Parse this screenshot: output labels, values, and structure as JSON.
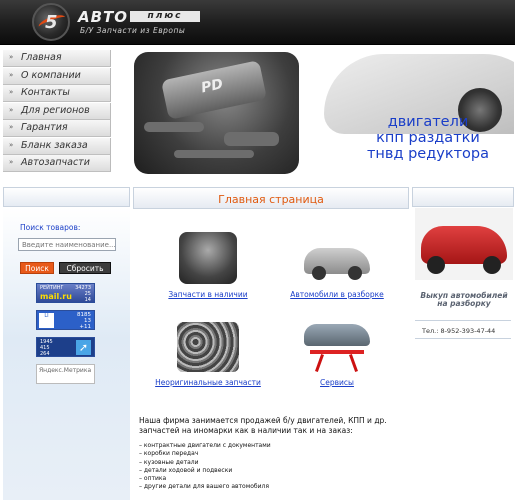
{
  "header": {
    "logo_number": "5",
    "brand": "АВТО",
    "brand_plus": "плюс",
    "tagline": "Б/У Запчасти из Европы"
  },
  "nav": {
    "items": [
      {
        "label": "Главная"
      },
      {
        "label": "О компании"
      },
      {
        "label": "Контакты"
      },
      {
        "label": "Для регионов"
      },
      {
        "label": "Гарантия"
      },
      {
        "label": "Бланк заказа"
      },
      {
        "label": "Автозапчасти"
      }
    ]
  },
  "banner": {
    "engine_badge": "PD",
    "line1": "двигатели",
    "line2": "кпп раздатки",
    "line3": "тнвд редуктора"
  },
  "search": {
    "label": "Поиск товаров:",
    "placeholder": "Введите наименование...",
    "search_button": "Поиск",
    "reset_button": "Сбросить"
  },
  "counters": {
    "mail": {
      "brand_top": "РЕЙТИНГ",
      "brand": "mail.ru",
      "nums": [
        "34273",
        "25",
        "14"
      ]
    },
    "li": {
      "icon_text": "LI",
      "nums": [
        "8185",
        "13",
        "+11"
      ]
    },
    "hotlog": {
      "nums": [
        "1945",
        "415",
        "264"
      ]
    },
    "yandex": {
      "label": "Яндекс.Метрика"
    }
  },
  "main": {
    "title": "Главная страница",
    "tiles": [
      {
        "caption": "Запчасти в наличии"
      },
      {
        "caption": "Автомобили в разборке"
      },
      {
        "caption": "Неоригинальные запчасти"
      },
      {
        "caption": "Сервисы"
      }
    ],
    "about": "Наша фирма занимается продажей б/у двигателей, КПП и др. запчастей на иномарки как в наличии так и на заказ:",
    "list": [
      "– контрактные двигатели с документами",
      "– коробки передач",
      "– кузовные детали",
      "– детали ходовой и подвески",
      "– оптика",
      "– другие детали для вашего автомобиля"
    ]
  },
  "right": {
    "promo": "Выкуп автомобилей на разборку",
    "phone": "Тел.: 8-952-393-47-44"
  }
}
